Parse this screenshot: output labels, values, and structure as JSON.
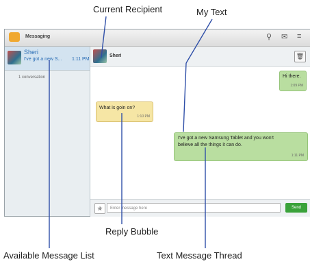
{
  "callouts": {
    "current_recipient": "Current Recipient",
    "my_text": "My Text",
    "reply_bubble": "Reply Bubble",
    "message_list": "Available Message List",
    "thread": "Text Message Thread"
  },
  "app": {
    "title": "Messaging",
    "icons": [
      "messaging-app-icon",
      "search-icon",
      "new-message-icon",
      "menu-icon"
    ]
  },
  "sidebar": {
    "conversation": {
      "name": "Sheri",
      "preview": "I've got a new S...",
      "time": "1:11 PM"
    },
    "count_text": "1 conversation"
  },
  "thread": {
    "recipient": "Sheri",
    "messages": [
      {
        "type": "mine",
        "text": "Hi there.",
        "time": "1:09 PM"
      },
      {
        "type": "reply",
        "text": "What is goin on?",
        "time": "1:10 PM"
      },
      {
        "type": "mine",
        "text_line1": "I've got a new Samsung Tablet and you won't",
        "text_line2": "believe all the things it can do.",
        "time": "1:11 PM"
      }
    ],
    "compose": {
      "placeholder": "Enter message here",
      "send_label": "Send"
    }
  },
  "colors": {
    "mine_bubble": "#b9dea0",
    "reply_bubble": "#f6e6a5",
    "send_button": "#3aa23a",
    "link_blue": "#2a6db5"
  }
}
